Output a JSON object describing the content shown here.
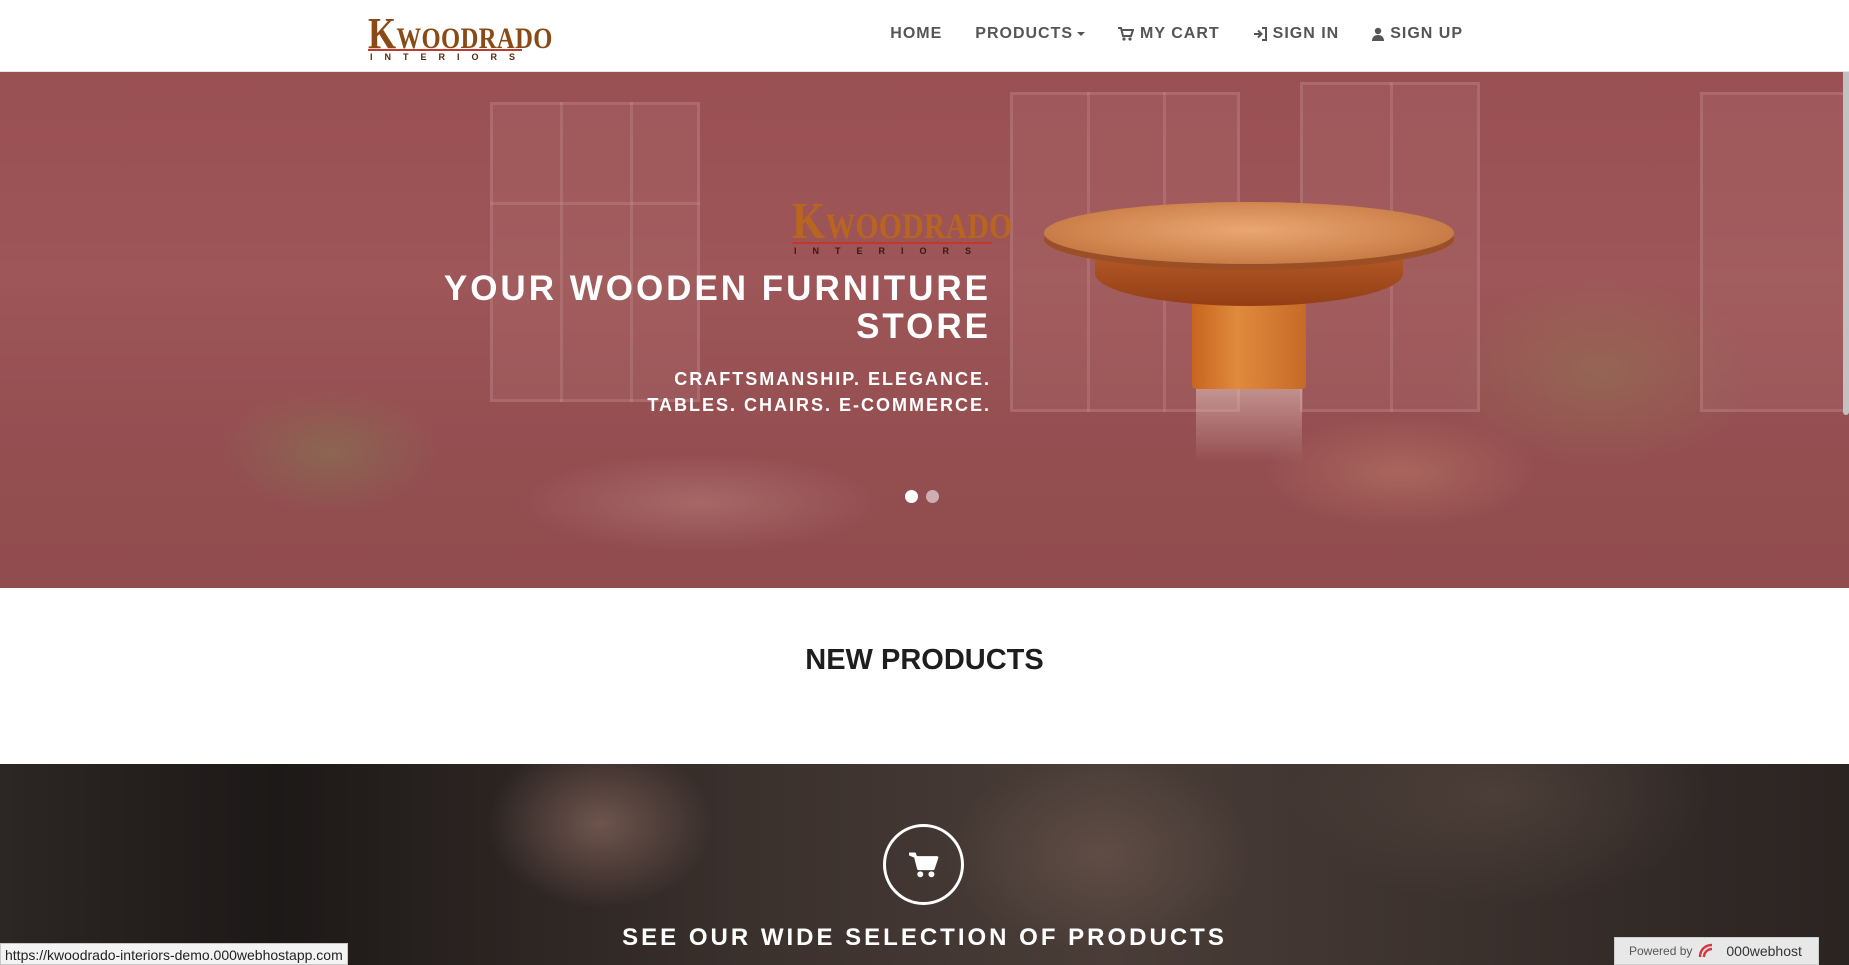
{
  "brand": {
    "name_initial": "K",
    "name_rest": "WOODRADO",
    "tagline": "INTERIORS"
  },
  "nav": {
    "items": [
      {
        "label": "HOME",
        "icon": ""
      },
      {
        "label": "PRODUCTS",
        "icon": "caret-down-icon"
      },
      {
        "label": "MY CART",
        "icon": "shopping-cart-icon"
      },
      {
        "label": "SIGN IN",
        "icon": "sign-in-icon"
      },
      {
        "label": "SIGN UP",
        "icon": "user-icon"
      }
    ]
  },
  "hero": {
    "title": "YOUR WOODEN FURNITURE STORE",
    "subtitle_line1": "CRAFTSMANSHIP. ELEGANCE.",
    "subtitle_line2": "TABLES. CHAIRS. E-COMMERCE.",
    "slides": 2,
    "active_slide": 1
  },
  "new_products": {
    "heading": "NEW PRODUCTS"
  },
  "cta": {
    "heading": "SEE OUR WIDE SELECTION OF PRODUCTS",
    "icon": "shopping-cart-icon"
  },
  "status": {
    "url": "https://kwoodrado-interiors-demo.000webhostapp.com"
  },
  "powered_by": {
    "label": "Powered by",
    "brand": "000webhost"
  },
  "colors": {
    "brand_brown": "#8a4a16",
    "hero_tint": "#9a5356",
    "nav_text": "#555555",
    "dark_section": "#2c2624"
  }
}
